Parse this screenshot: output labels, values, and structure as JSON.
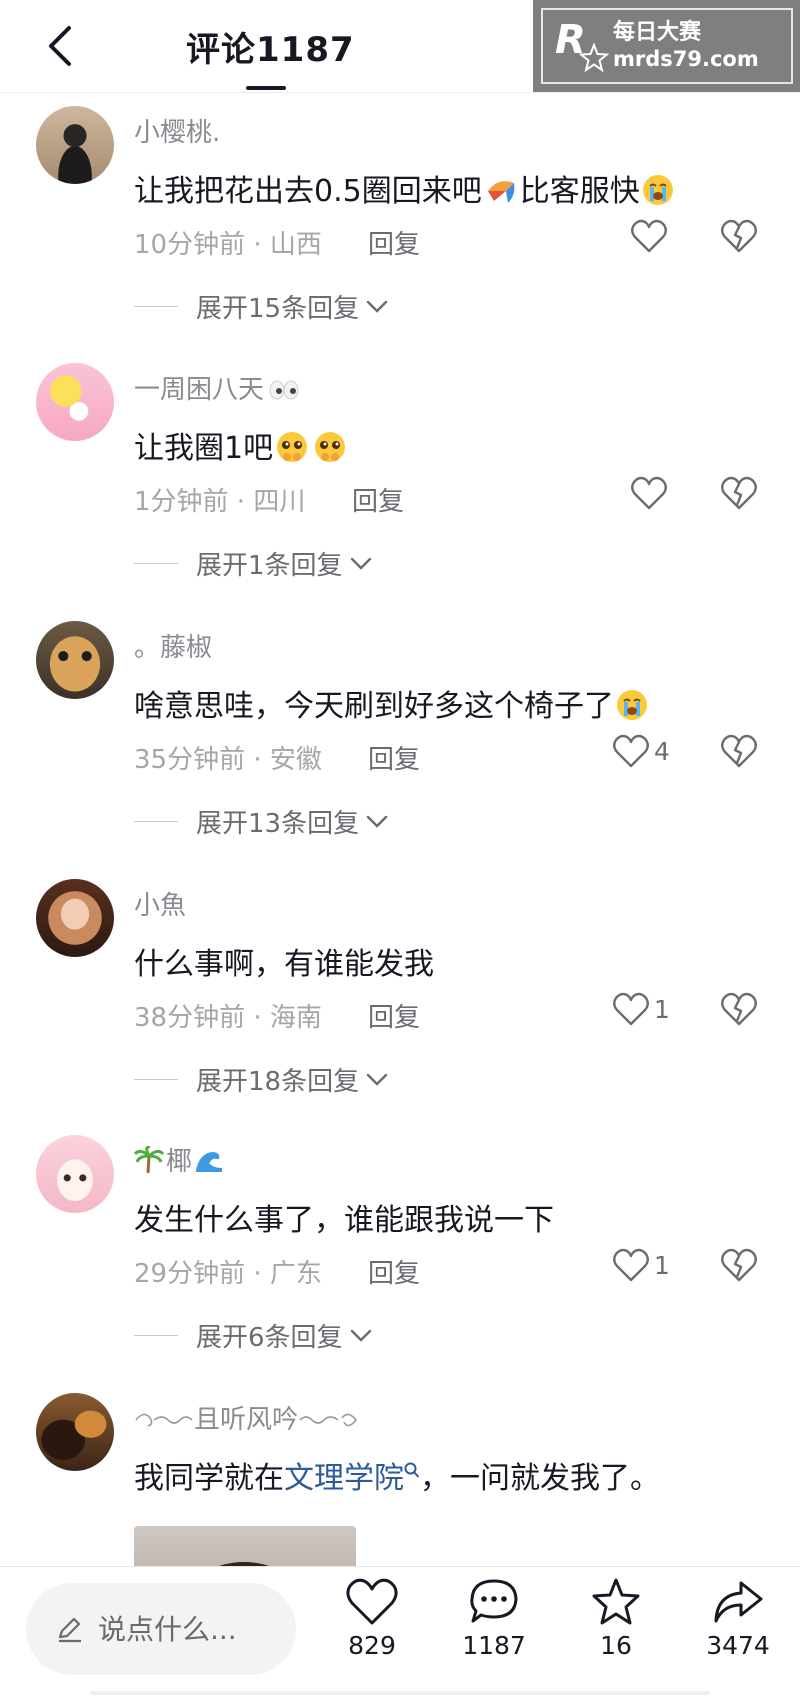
{
  "header": {
    "title": "评论1187"
  },
  "watermark": {
    "logo_letter": "R",
    "name": "每日大赛",
    "url": "mrds79.com"
  },
  "comments": [
    {
      "user": "小樱桃.",
      "text": "让我把花出去0.5圈回来吧",
      "text_suffix": "比客服快",
      "time_location": "10分钟前 · 山西",
      "reply_label": "回复",
      "likes": "",
      "expand": "展开15条回复"
    },
    {
      "user": "一周困八天",
      "text": "让我圈1吧",
      "time_location": "1分钟前 · 四川",
      "reply_label": "回复",
      "likes": "",
      "expand": "展开1条回复"
    },
    {
      "user": "。藤椒",
      "text": "啥意思哇，今天刷到好多这个椅子了",
      "time_location": "35分钟前 · 安徽",
      "reply_label": "回复",
      "likes": "4",
      "expand": "展开13条回复"
    },
    {
      "user": "小魚",
      "text": "什么事啊，有谁能发我",
      "time_location": "38分钟前 · 海南",
      "reply_label": "回复",
      "likes": "1",
      "expand": "展开18条回复"
    },
    {
      "user": "椰",
      "text": "发生什么事了，谁能跟我说一下",
      "time_location": "29分钟前 · 广东",
      "reply_label": "回复",
      "likes": "1",
      "expand": "展开6条回复"
    },
    {
      "user": "且听风吟",
      "text_before": "我同学就在",
      "link": "文理学院",
      "text_after": "，一问就发我了。"
    }
  ],
  "bottom_bar": {
    "input_placeholder": "说点什么...",
    "like_count": "829",
    "comment_count": "1187",
    "favorite_count": "16",
    "share_count": "3474"
  },
  "colors": {
    "link": "#2b5b9c",
    "text": "#161823",
    "meta": "#a5a6aa"
  }
}
